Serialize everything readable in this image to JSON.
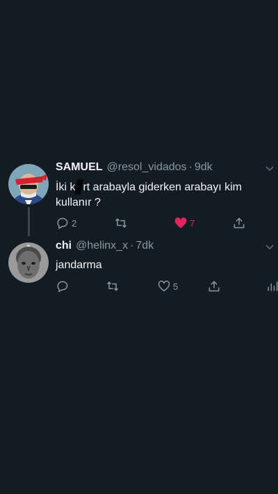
{
  "tweets": [
    {
      "name": "SAMUEL",
      "handle": "@resol_vidados",
      "separator": "·",
      "time": "9dk",
      "text_part1": "İki k",
      "text_part2": "rt arabayla giderken arabayı kim kullanır ?",
      "replies": "2",
      "likes": "7",
      "liked": true,
      "avatar_icon": "masked-man-avatar"
    },
    {
      "name": "chi",
      "handle": "@helinx_x",
      "separator": "·",
      "time": "7dk",
      "text": "jandarma",
      "likes": "5",
      "avatar_icon": "child-portrait-avatar"
    }
  ],
  "colors": {
    "background": "#141c23",
    "secondary_text": "#8899a6",
    "like_active": "#e0245e"
  }
}
